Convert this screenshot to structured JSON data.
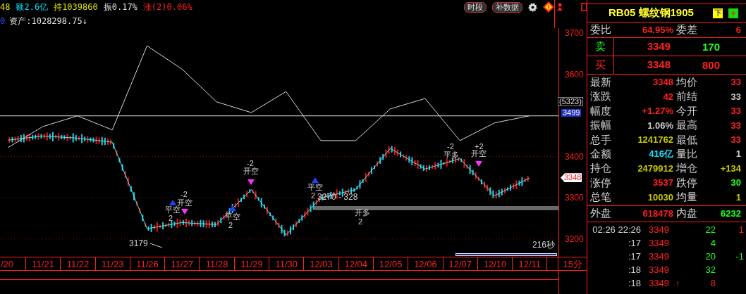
{
  "top_bar": {
    "row1": [
      {
        "text": "48",
        "color": "#e0e000"
      },
      {
        "text": "额2.6亿",
        "color": "#00e0ff"
      },
      {
        "text": "持1039860",
        "color": "#e0e000"
      },
      {
        "text": "振0.17%",
        "color": "#e0e0e0"
      },
      {
        "text": "涨(2)0.06%",
        "color": "#ff2020"
      }
    ],
    "row2": [
      {
        "text": "0",
        "color": "#3050ff"
      },
      {
        "text": "资产:1028298.75↓",
        "color": "#e0e0e0"
      }
    ],
    "buttons": [
      "时段",
      "补数据"
    ]
  },
  "chart": {
    "chart_data": {
      "type": "line",
      "categories": [
        "/20",
        "11/21",
        "11/22",
        "11/23",
        "11/26",
        "11/27",
        "11/28",
        "11/29",
        "11/30",
        "12/03",
        "12/04",
        "12/05",
        "12/06",
        "12/07",
        "12/10",
        "12/11"
      ],
      "series": [
        {
          "color": "#40f0f0",
          "values": [
            3440,
            3450,
            3445,
            3435,
            3225,
            3240,
            3235,
            3320,
            3210,
            3300,
            3320,
            3420,
            3370,
            3395,
            3305,
            3348
          ]
        },
        {
          "color": "#d8d8d8",
          "values": [
            3422,
            3473,
            3499,
            3465,
            3669,
            3613,
            3533,
            3507,
            3558,
            3439,
            3439,
            3516,
            3541,
            3439,
            3482,
            3499
          ]
        }
      ],
      "yticks": [
        3200,
        3300,
        3400,
        3600,
        3700
      ],
      "ylim": [
        3157,
        3712
      ],
      "grid": true,
      "ref_lines": [
        {
          "axis": "y",
          "value": 3499,
          "label": "3499"
        }
      ],
      "bands": [
        {
          "axis": "y",
          "from": 3270,
          "to": 3280,
          "label": "3270 - 328"
        }
      ]
    },
    "period": "15分",
    "low_label": "3179",
    "timer": "216秒",
    "position_label": "(5323)",
    "last_price": "3348",
    "markers": [
      {
        "kind": "up",
        "label": "平空",
        "qty": "2"
      },
      {
        "kind": "down",
        "label": "开空",
        "qty": "-2"
      },
      {
        "kind": "up",
        "label": "平空",
        "qty": "2"
      },
      {
        "kind": "down",
        "label": "开空",
        "qty": "-2"
      },
      {
        "kind": "up",
        "label": "平空",
        "qty": "2"
      },
      {
        "kind": "text",
        "label": "开多",
        "qty": "2"
      },
      {
        "kind": "text",
        "label": "平多",
        "qty": "-2"
      },
      {
        "kind": "down",
        "label": "开空",
        "qty": "+2"
      }
    ]
  },
  "quote": {
    "title": "RB05 螺纹钢1905",
    "down_button": "下",
    "ratio": [
      {
        "label": "委比",
        "value": "64.95%",
        "color": "#ff2020"
      },
      {
        "label": "委差",
        "value": "6",
        "color": "#ff2020"
      }
    ],
    "book": [
      {
        "side": {
          "text": "卖",
          "color": "#20ff20"
        },
        "price": "3349",
        "volume": {
          "text": "170",
          "color": "#20ff20"
        }
      },
      {
        "side": {
          "text": "买",
          "color": "#ff2020"
        },
        "price": "3348",
        "volume": {
          "text": "800",
          "color": "#ff2020"
        }
      }
    ],
    "stats": [
      {
        "label": "最新",
        "value": "3348",
        "color": "#ff2020"
      },
      {
        "label": "均价",
        "value": "33",
        "color": "#ff2020"
      },
      {
        "label": "涨跌",
        "value": "42",
        "color": "#ff2020"
      },
      {
        "label": "前结",
        "value": "33",
        "color": "#c8c8c8"
      },
      {
        "label": "幅度",
        "value": "+1.27%",
        "color": "#ff2020"
      },
      {
        "label": "今开",
        "value": "33",
        "color": "#ff2020"
      },
      {
        "label": "振幅",
        "value": "1.06%",
        "color": "#c8c8c8"
      },
      {
        "label": "最高",
        "value": "33",
        "color": "#ff2020"
      },
      {
        "label": "总手",
        "value": "1241762",
        "color": "#c8c800"
      },
      {
        "label": "最低",
        "value": "33",
        "color": "#ff2020"
      },
      {
        "label": "金额",
        "value": "416亿",
        "color": "#20e0ff"
      },
      {
        "label": "量比",
        "value": "1",
        "color": "#c8c8c8"
      },
      {
        "label": "持仓",
        "value": "2479912",
        "color": "#c8c800"
      },
      {
        "label": "增仓",
        "value": "+134",
        "color": "#c8c800"
      },
      {
        "label": "涨停",
        "value": "3537",
        "color": "#ff2020"
      },
      {
        "label": "跌停",
        "value": "30",
        "color": "#20ff20"
      },
      {
        "label": "总笔",
        "value": "10030",
        "color": "#c8c800"
      },
      {
        "label": "均量",
        "value": "1",
        "color": "#c8c800"
      }
    ],
    "outer": [
      {
        "label": "外盘",
        "value": "618478",
        "color": "#ff2020"
      },
      {
        "label": "内盘",
        "value": "6232",
        "color": "#20ff20"
      }
    ],
    "ticks": [
      {
        "time": "02:26 22:26",
        "price": "3349",
        "volume": {
          "text": "22",
          "color": "#20ff20"
        },
        "change": {
          "text": "1",
          "color": "#ff2020"
        }
      },
      {
        "time": ":17",
        "price": "3349",
        "volume": {
          "text": "4",
          "color": "#20ff20"
        }
      },
      {
        "time": ":17",
        "price": "3349",
        "volume": {
          "text": "20",
          "color": "#20ff20"
        },
        "change": {
          "text": "-1",
          "color": "#20ff20"
        }
      },
      {
        "time": ":18",
        "price": "3349",
        "volume": {
          "text": "32",
          "color": "#20ff20"
        }
      },
      {
        "time": ":18",
        "price": "3349",
        "arrow": "↑",
        "volume": {
          "text": "8",
          "color": "#ff2020"
        }
      }
    ]
  }
}
